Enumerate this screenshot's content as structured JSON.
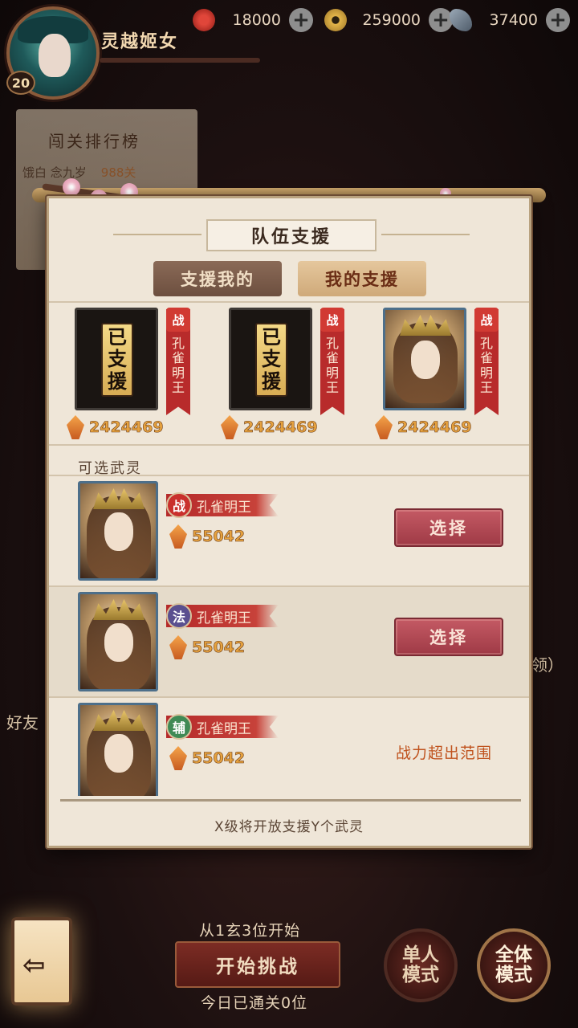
{
  "player": {
    "name": "灵越姬女",
    "level": "20"
  },
  "currencies": [
    {
      "name": "jade",
      "icon": "red-swirl-icon",
      "value": "18000",
      "color": "#c62b2b"
    },
    {
      "name": "coins",
      "icon": "coin-icon",
      "value": "259000",
      "color": "#d9a63f"
    },
    {
      "name": "feathers",
      "icon": "feather-icon",
      "value": "37400",
      "color": "#6f7f90"
    }
  ],
  "ranking": {
    "title": "闯关排行榜",
    "top_row": {
      "name": "饿白 念九岁",
      "level": "988关"
    }
  },
  "background": {
    "side_text": "领）",
    "friend_text": "好友"
  },
  "modal": {
    "title": "队伍支援",
    "tabs": [
      {
        "label": "支援我的",
        "active": false
      },
      {
        "label": "我的支援",
        "active": true
      }
    ],
    "slots": [
      {
        "supported": true,
        "mark": [
          "已",
          "支",
          "援"
        ],
        "type": "战",
        "name": [
          "孔",
          "雀",
          "明",
          "王"
        ],
        "power": "2424469"
      },
      {
        "supported": true,
        "mark": [
          "已",
          "支",
          "援"
        ],
        "type": "战",
        "name": [
          "孔",
          "雀",
          "明",
          "王"
        ],
        "power": "2424469"
      },
      {
        "supported": false,
        "type": "战",
        "name": [
          "孔",
          "雀",
          "明",
          "王"
        ],
        "power": "2424469"
      }
    ],
    "section_label": "可选武灵",
    "list": [
      {
        "type": "战",
        "type_color": "#c9302c",
        "name": "孔雀明王",
        "power": "55042",
        "action": "选择",
        "selectable": true
      },
      {
        "type": "法",
        "type_color": "#5a4f8f",
        "name": "孔雀明王",
        "power": "55042",
        "action": "选择",
        "selectable": true
      },
      {
        "type": "辅",
        "type_color": "#3f8a55",
        "name": "孔雀明王",
        "power": "55042",
        "action": "战力超出范围",
        "selectable": false
      }
    ],
    "footer_note": "X级将开放支援Y个武灵"
  },
  "bottom": {
    "start_hint": "从1玄3位开始",
    "start_button": "开始挑战",
    "cleared_text": "今日已通关0位",
    "single_mode": [
      "单人",
      "模式"
    ],
    "all_mode": [
      "全体",
      "模式"
    ]
  }
}
